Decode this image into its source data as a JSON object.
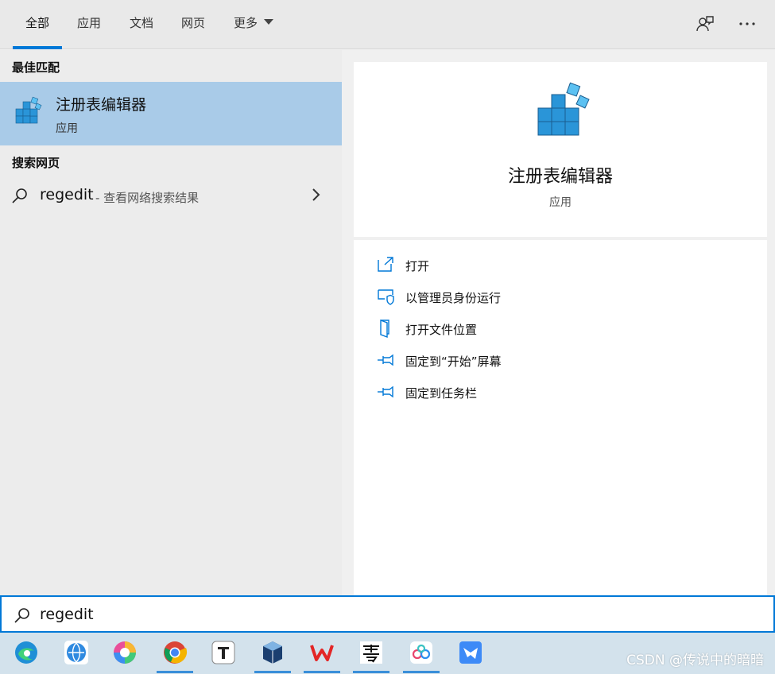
{
  "tabs": [
    {
      "label": "全部",
      "active": true
    },
    {
      "label": "应用",
      "active": false
    },
    {
      "label": "文档",
      "active": false
    },
    {
      "label": "网页",
      "active": false
    },
    {
      "label": "更多",
      "active": false
    }
  ],
  "topbar_icons": [
    "feedback-icon",
    "more-options-icon"
  ],
  "left": {
    "best_match_title": "最佳匹配",
    "best_match": {
      "name": "注册表编辑器",
      "type": "应用",
      "icon": "registry-editor-icon"
    },
    "web_title": "搜索网页",
    "web_result": {
      "query": "regedit",
      "hint": "- 查看网络搜索结果"
    }
  },
  "right": {
    "app_name": "注册表编辑器",
    "app_type": "应用",
    "actions": [
      {
        "label": "打开",
        "icon": "open-icon"
      },
      {
        "label": "以管理员身份运行",
        "icon": "run-as-admin-icon"
      },
      {
        "label": "打开文件位置",
        "icon": "file-location-icon"
      },
      {
        "label": "固定到“开始”屏幕",
        "icon": "pin-icon"
      },
      {
        "label": "固定到任务栏",
        "icon": "pin-icon"
      }
    ]
  },
  "search": {
    "value": "regedit"
  },
  "taskbar": {
    "apps": [
      "edge-icon",
      "browser-icon",
      "photos-icon",
      "chrome-icon",
      "typora-icon",
      "virtualbox-icon",
      "wps-icon",
      "yun-icon",
      "cloud-drive-icon",
      "feishu-icon"
    ],
    "watermark": "CSDN @传说中的暗暗"
  },
  "colors": {
    "accent": "#0078d7",
    "selection": "#a9cbe8",
    "taskbar": "#d3e2ec"
  }
}
